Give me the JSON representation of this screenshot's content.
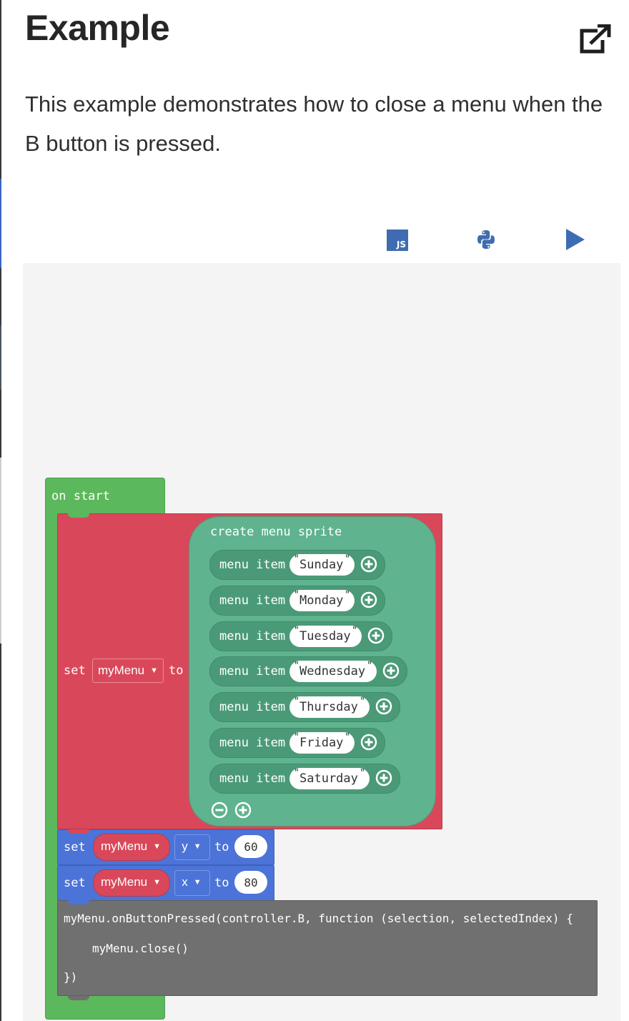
{
  "page": {
    "title": "Example",
    "description": "This example demonstrates how to close a menu when the B button is pressed."
  },
  "toolbar": {
    "js_label": "JS"
  },
  "blocks": {
    "on_start": "on start",
    "set_label": "set",
    "to_label": "to",
    "variable": "myMenu",
    "create_menu": "create menu sprite",
    "menu_item_label": "menu item",
    "menu_items": [
      "Sunday",
      "Monday",
      "Tuesday",
      "Wednesday",
      "Thursday",
      "Friday",
      "Saturday"
    ],
    "set_y": {
      "prop": "y",
      "value": "60"
    },
    "set_x": {
      "prop": "x",
      "value": "80"
    },
    "code": {
      "line1": "myMenu.onButtonPressed(controller.B, function (selection, selectedIndex) {",
      "line2": "myMenu.close()",
      "line3": "})"
    }
  },
  "colors": {
    "on_start": "#5cb85c",
    "sprite_set": "#d9485a",
    "menu": "#5fb38f",
    "menu_item": "#4b9a77",
    "set_property": "#4c73d7",
    "grey_code": "#707070",
    "accent_blue": "#3f6cb0"
  }
}
